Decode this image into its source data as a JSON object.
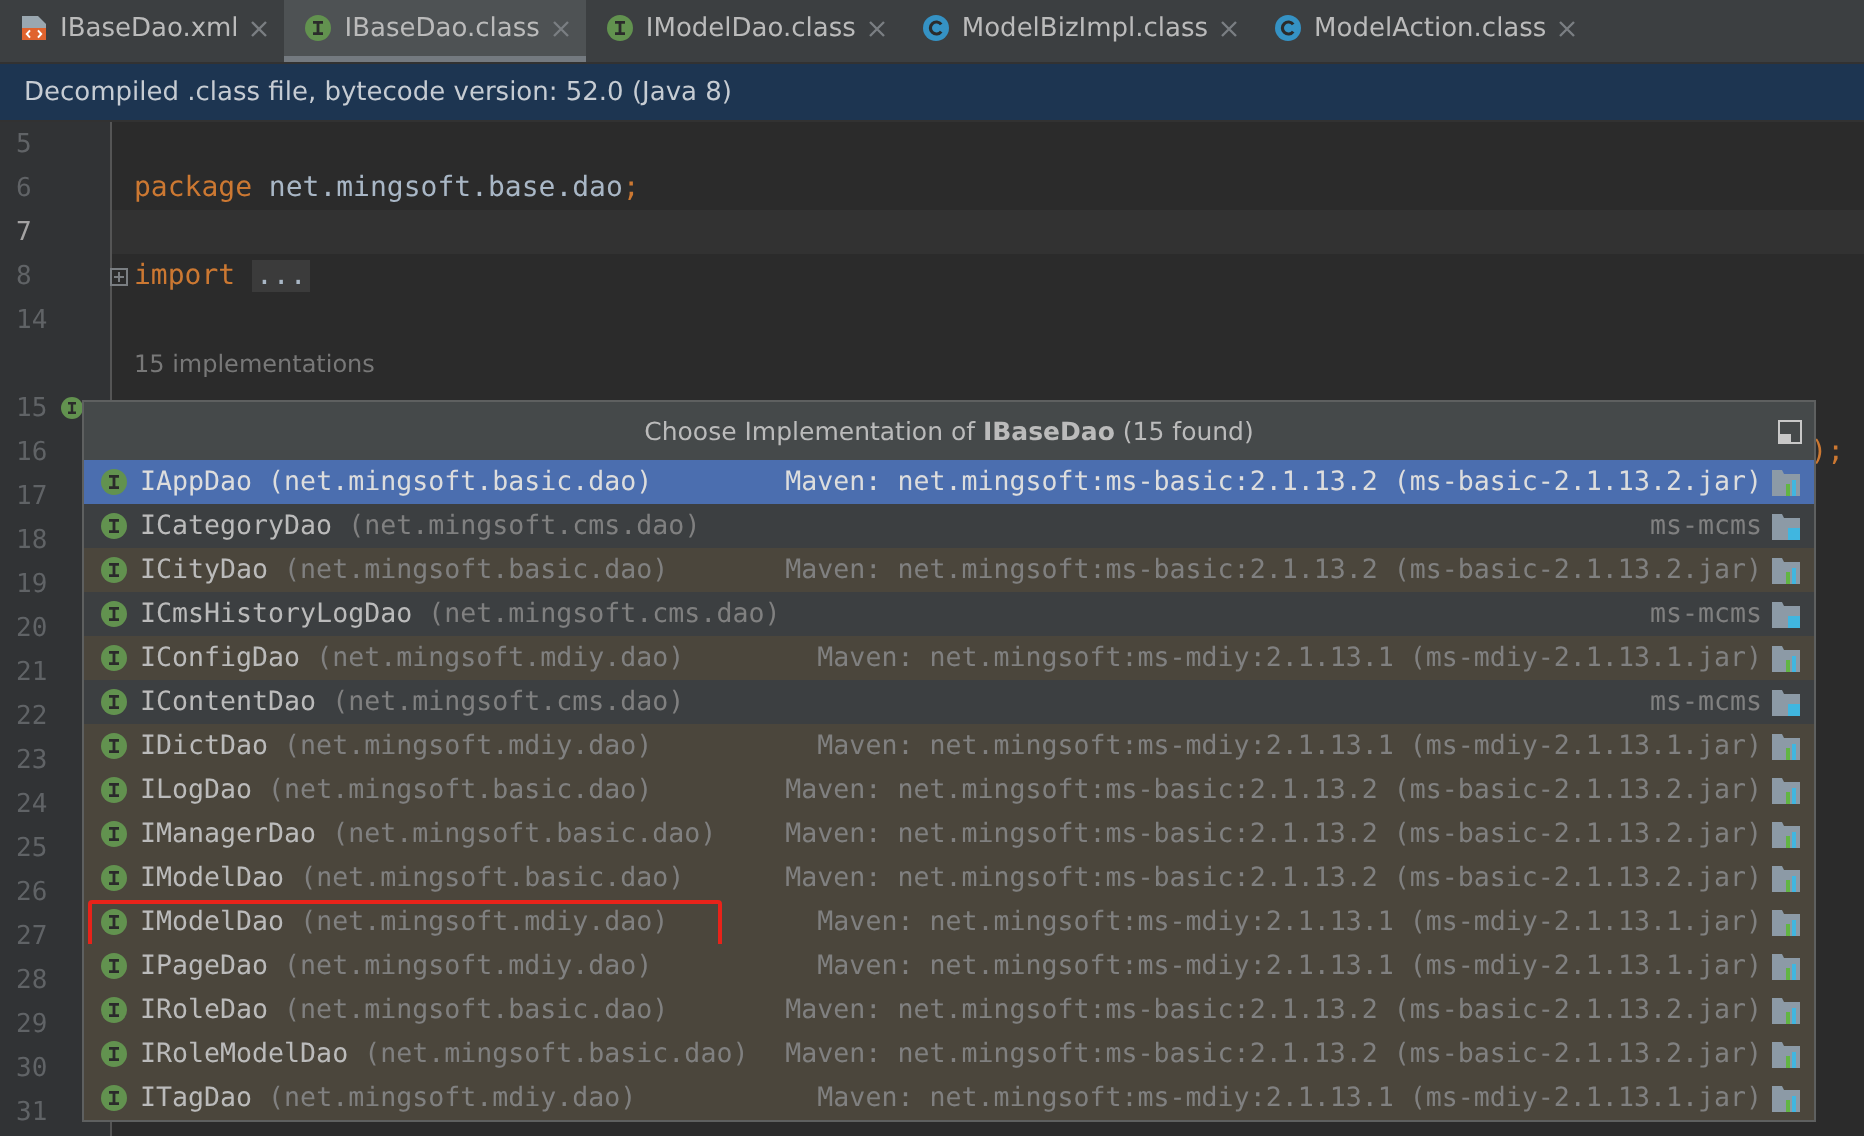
{
  "tabs": [
    {
      "label": "IBaseDao.xml",
      "kind": "xml",
      "selected": false
    },
    {
      "label": "IBaseDao.class",
      "kind": "interface",
      "selected": true
    },
    {
      "label": "IModelDao.class",
      "kind": "interface",
      "selected": false
    },
    {
      "label": "ModelBizImpl.class",
      "kind": "class",
      "selected": false
    },
    {
      "label": "ModelAction.class",
      "kind": "class",
      "selected": false
    }
  ],
  "banner": "Decompiled .class file, bytecode version: 52.0 (Java 8)",
  "editor": {
    "lines": [
      {
        "number": "5",
        "current": false
      },
      {
        "number": "6",
        "current": false,
        "segments": [
          {
            "text": "package",
            "kind": "keyword"
          },
          {
            "text": "net.mingsoft.base.dao",
            "kind": "ident"
          },
          {
            "text": ";",
            "kind": "punct"
          }
        ]
      },
      {
        "number": "7",
        "current": true
      },
      {
        "number": "8",
        "current": false,
        "fold": true,
        "segments": [
          {
            "text": "import",
            "kind": "keyword"
          },
          {
            "text": "...",
            "kind": "folded"
          }
        ]
      },
      {
        "number": "14",
        "current": false
      },
      {
        "hint": "15 implementations"
      },
      {
        "number": "15",
        "current": false,
        "implemented": true
      },
      {
        "number": "16",
        "current": false,
        "tail": ");"
      },
      {
        "number": "17",
        "current": false
      },
      {
        "number": "18",
        "current": false
      },
      {
        "number": "19",
        "current": false
      },
      {
        "number": "20",
        "current": false
      },
      {
        "number": "21",
        "current": false
      },
      {
        "number": "22",
        "current": false
      },
      {
        "number": "23",
        "current": false
      },
      {
        "number": "24",
        "current": false
      },
      {
        "number": "25",
        "current": false
      },
      {
        "number": "26",
        "current": false
      },
      {
        "number": "27",
        "current": false
      },
      {
        "number": "28",
        "current": false
      },
      {
        "number": "29",
        "current": false
      },
      {
        "number": "30",
        "current": false
      },
      {
        "number": "31",
        "current": false
      }
    ]
  },
  "popup": {
    "title": "Choose Implementation of **IBaseDao** (15 found)",
    "rows": [
      {
        "name": "IAppDao",
        "package": "(net.mingsoft.basic.dao)",
        "location": "Maven: net.mingsoft:ms-basic:2.1.13.2 (ms-basic-2.1.13.2.jar)",
        "kind": "library",
        "selected": true,
        "outlined": false
      },
      {
        "name": "ICategoryDao",
        "package": "(net.mingsoft.cms.dao)",
        "location": "ms-mcms",
        "kind": "module",
        "selected": false,
        "outlined": false
      },
      {
        "name": "ICityDao",
        "package": "(net.mingsoft.basic.dao)",
        "location": "Maven: net.mingsoft:ms-basic:2.1.13.2 (ms-basic-2.1.13.2.jar)",
        "kind": "library",
        "selected": false,
        "outlined": false
      },
      {
        "name": "ICmsHistoryLogDao",
        "package": "(net.mingsoft.cms.dao)",
        "location": "ms-mcms",
        "kind": "module",
        "selected": false,
        "outlined": false
      },
      {
        "name": "IConfigDao",
        "package": "(net.mingsoft.mdiy.dao)",
        "location": "Maven: net.mingsoft:ms-mdiy:2.1.13.1 (ms-mdiy-2.1.13.1.jar)",
        "kind": "library",
        "selected": false,
        "outlined": false
      },
      {
        "name": "IContentDao",
        "package": "(net.mingsoft.cms.dao)",
        "location": "ms-mcms",
        "kind": "module",
        "selected": false,
        "outlined": false
      },
      {
        "name": "IDictDao",
        "package": "(net.mingsoft.mdiy.dao)",
        "location": "Maven: net.mingsoft:ms-mdiy:2.1.13.1 (ms-mdiy-2.1.13.1.jar)",
        "kind": "library",
        "selected": false,
        "outlined": false
      },
      {
        "name": "ILogDao",
        "package": "(net.mingsoft.basic.dao)",
        "location": "Maven: net.mingsoft:ms-basic:2.1.13.2 (ms-basic-2.1.13.2.jar)",
        "kind": "library",
        "selected": false,
        "outlined": false
      },
      {
        "name": "IManagerDao",
        "package": "(net.mingsoft.basic.dao)",
        "location": "Maven: net.mingsoft:ms-basic:2.1.13.2 (ms-basic-2.1.13.2.jar)",
        "kind": "library",
        "selected": false,
        "outlined": false
      },
      {
        "name": "IModelDao",
        "package": "(net.mingsoft.basic.dao)",
        "location": "Maven: net.mingsoft:ms-basic:2.1.13.2 (ms-basic-2.1.13.2.jar)",
        "kind": "library",
        "selected": false,
        "outlined": false
      },
      {
        "name": "IModelDao",
        "package": "(net.mingsoft.mdiy.dao)",
        "location": "Maven: net.mingsoft:ms-mdiy:2.1.13.1 (ms-mdiy-2.1.13.1.jar)",
        "kind": "library",
        "selected": false,
        "outlined": true
      },
      {
        "name": "IPageDao",
        "package": "(net.mingsoft.mdiy.dao)",
        "location": "Maven: net.mingsoft:ms-mdiy:2.1.13.1 (ms-mdiy-2.1.13.1.jar)",
        "kind": "library",
        "selected": false,
        "outlined": false
      },
      {
        "name": "IRoleDao",
        "package": "(net.mingsoft.basic.dao)",
        "location": "Maven: net.mingsoft:ms-basic:2.1.13.2 (ms-basic-2.1.13.2.jar)",
        "kind": "library",
        "selected": false,
        "outlined": false
      },
      {
        "name": "IRoleModelDao",
        "package": "(net.mingsoft.basic.dao)",
        "location": "Maven: net.mingsoft:ms-basic:2.1.13.2 (ms-basic-2.1.13.2.jar)",
        "kind": "library",
        "selected": false,
        "outlined": false
      },
      {
        "name": "ITagDao",
        "package": "(net.mingsoft.mdiy.dao)",
        "location": "Maven: net.mingsoft:ms-mdiy:2.1.13.1 (ms-mdiy-2.1.13.1.jar)",
        "kind": "library",
        "selected": false,
        "outlined": false
      }
    ]
  }
}
